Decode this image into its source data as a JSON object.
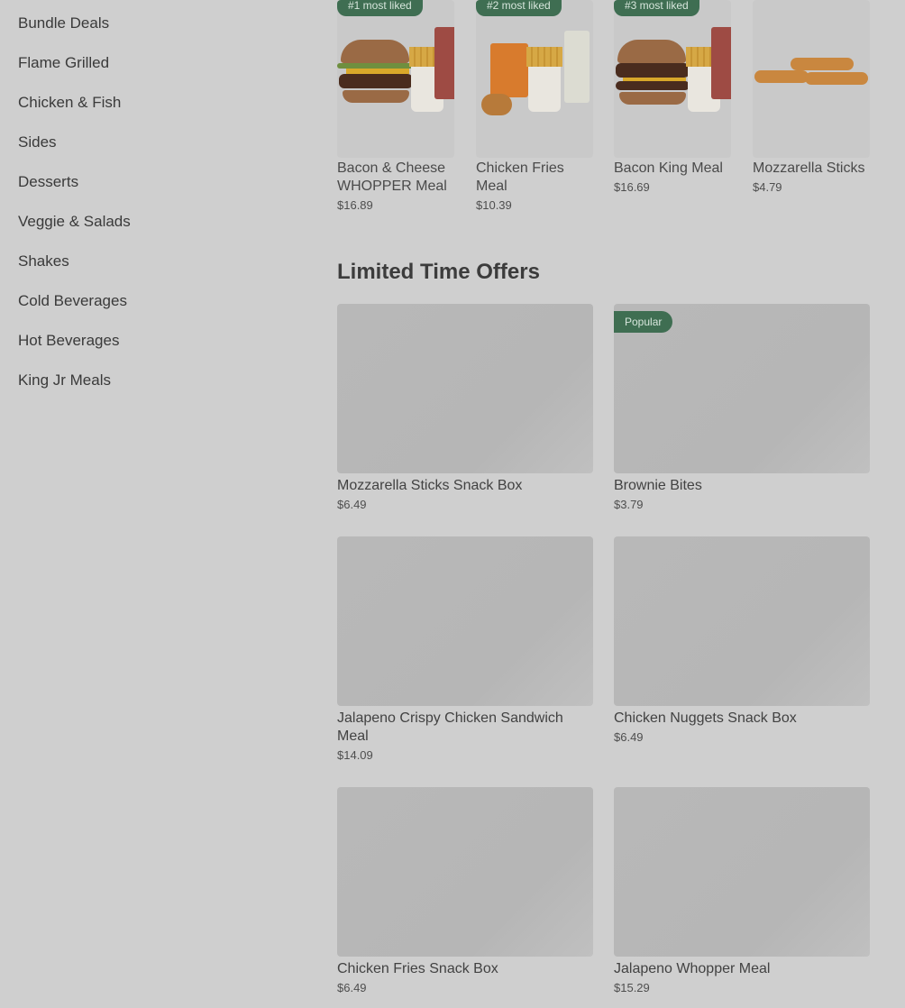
{
  "sidebar": {
    "items": [
      {
        "label": "Bundle Deals"
      },
      {
        "label": "Flame Grilled"
      },
      {
        "label": "Chicken & Fish"
      },
      {
        "label": "Sides"
      },
      {
        "label": "Desserts"
      },
      {
        "label": "Veggie & Salads"
      },
      {
        "label": "Shakes"
      },
      {
        "label": "Cold Beverages"
      },
      {
        "label": "Hot Beverages"
      },
      {
        "label": "King Jr Meals"
      }
    ]
  },
  "most_liked": {
    "items": [
      {
        "badge": "#1 most liked",
        "name": "Bacon & Cheese WHOPPER Meal",
        "price": "$16.89"
      },
      {
        "badge": "#2 most liked",
        "name": "Chicken Fries Meal",
        "price": "$10.39"
      },
      {
        "badge": "#3 most liked",
        "name": "Bacon King Meal",
        "price": "$16.69"
      },
      {
        "badge": "",
        "name": "Mozzarella Sticks",
        "price": "$4.79"
      }
    ]
  },
  "limited_time": {
    "title": "Limited Time Offers",
    "items": [
      {
        "name": "Mozzarella Sticks Snack Box",
        "price": "$6.49",
        "badge": ""
      },
      {
        "name": "Brownie Bites",
        "price": "$3.79",
        "badge": "Popular"
      },
      {
        "name": "Jalapeno Crispy Chicken Sandwich Meal",
        "price": "$14.09",
        "badge": ""
      },
      {
        "name": "Chicken Nuggets Snack Box",
        "price": "$6.49",
        "badge": ""
      },
      {
        "name": "Chicken Fries Snack Box",
        "price": "$6.49",
        "badge": ""
      },
      {
        "name": "Jalapeno Whopper Meal",
        "price": "$15.29",
        "badge": ""
      }
    ]
  },
  "colors": {
    "background": "#cfcfcf",
    "badge_green": "#3f6e52",
    "placeholder": "#b8b8b8"
  }
}
